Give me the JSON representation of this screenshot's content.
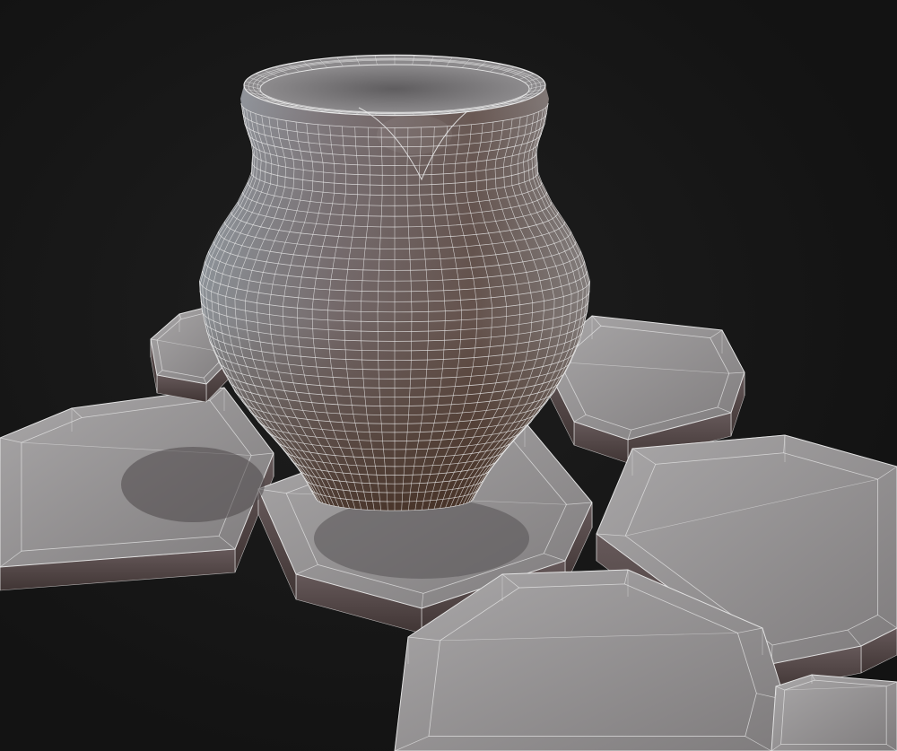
{
  "scene": {
    "subject": "wireframe-render",
    "colors": {
      "background": "#141414",
      "vignette": "#1e1e1e",
      "stone_top": "#8d8b8c",
      "stone_top_light": "#a7a5a6",
      "stone_side": "#5e5556",
      "stone_side_dark": "#463b3a",
      "vase_dark": "#4a3325",
      "vase_mid": "#6f5f5c",
      "vase_light": "#a4a8ad",
      "vase_inner": "#7d7a7c",
      "wire": "#e8e8e8"
    },
    "vase": {
      "rings": 40,
      "segments": 36
    }
  }
}
